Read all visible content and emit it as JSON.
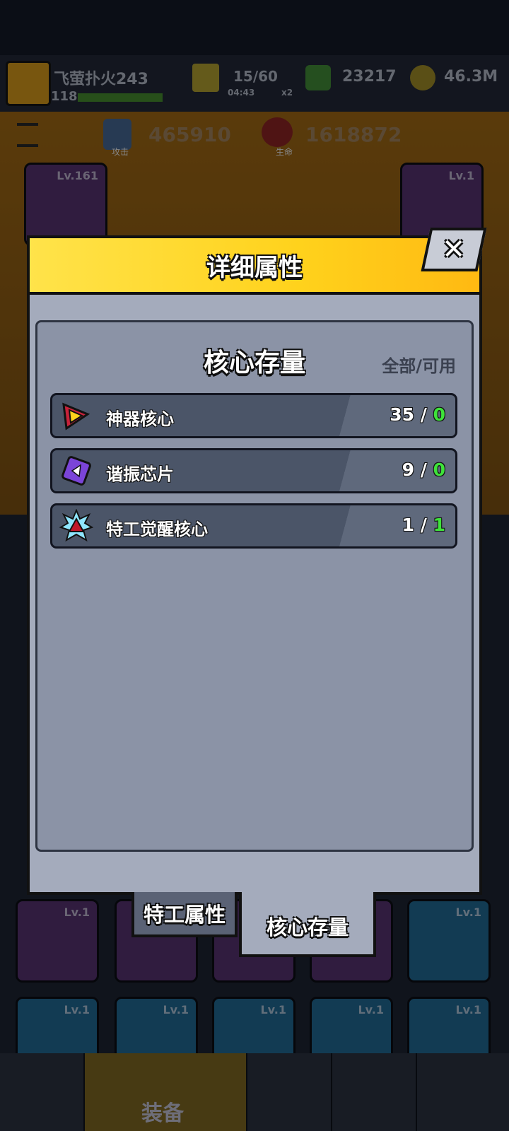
{
  "hud": {
    "player_name": "飞萤扑火243",
    "level": "118",
    "energy": "15/60",
    "energy_timer": "04:43",
    "energy_multiplier": "x2",
    "gems": "23217",
    "coins": "46.3M",
    "attack_label": "攻击",
    "attack_value": "465910",
    "hp_label": "生命",
    "hp_value": "1618872",
    "left_item_level": "Lv.161",
    "right_item_level": "Lv.1",
    "grid_level": "Lv.1",
    "nav_equipment_label": "装备"
  },
  "dialog": {
    "title": "详细属性",
    "close_symbol": "✕",
    "panel_title": "核心存量",
    "legend": "全部/可用",
    "rows": [
      {
        "name": "神器核心",
        "total": "35",
        "sep": " / ",
        "available": "0",
        "icon": "artifact-core-icon"
      },
      {
        "name": "谐振芯片",
        "total": "9",
        "sep": " / ",
        "available": "0",
        "icon": "resonance-chip-icon"
      },
      {
        "name": "特工觉醒核心",
        "total": "1",
        "sep": " / ",
        "available": "1",
        "icon": "agent-awaken-core-icon"
      }
    ],
    "tabs": {
      "agent_attributes": "特工属性",
      "core_inventory": "核心存量"
    }
  },
  "colors": {
    "header_yellow": "#ffd21c",
    "available_green": "#3ee23a",
    "dialog_bg": "#a4abbc"
  }
}
